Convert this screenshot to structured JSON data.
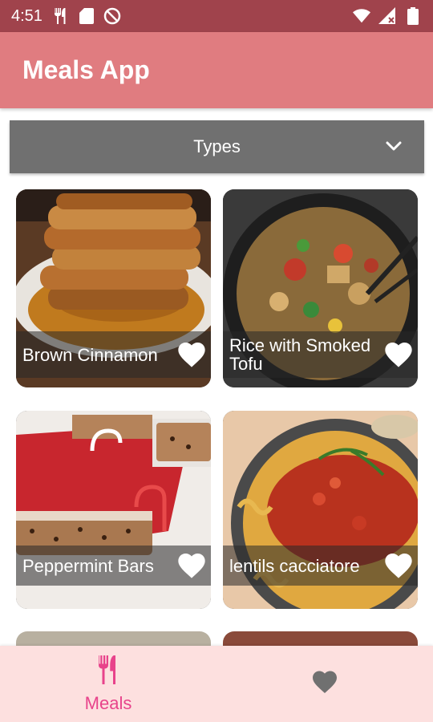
{
  "status_bar": {
    "time": "4:51",
    "left_icons": [
      "restaurant-icon",
      "sd-card-icon",
      "do-not-disturb-icon"
    ],
    "right_icons": [
      "wifi-icon",
      "signal-icon",
      "battery-icon"
    ]
  },
  "app_bar": {
    "title": "Meals App"
  },
  "filter": {
    "label": "Types",
    "icon": "chevron-down-icon"
  },
  "meals": [
    {
      "name": "Brown Cinnamon",
      "favorite": true
    },
    {
      "name": "Rice with Smoked Tofu",
      "favorite": true
    },
    {
      "name": "Peppermint Bars",
      "favorite": true
    },
    {
      "name": "lentils cacciatore",
      "favorite": true
    }
  ],
  "bottom_nav": {
    "items": [
      {
        "label": "Meals",
        "icon": "restaurant-icon",
        "active": true
      },
      {
        "label": "",
        "icon": "heart-icon",
        "active": false
      }
    ]
  },
  "colors": {
    "status_bar": "#a0434c",
    "app_bar": "#e07c80",
    "dropdown": "#707070",
    "bottom_nav": "#fde0df",
    "active_nav": "#e8438b",
    "inactive_nav": "#707070"
  }
}
